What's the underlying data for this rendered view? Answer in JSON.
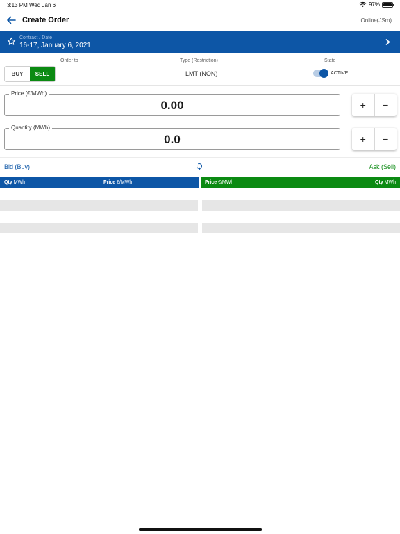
{
  "status_bar": {
    "time": "3:13 PM",
    "date": "Wed Jan 6",
    "battery": "97%",
    "battery_level": 0.97
  },
  "header": {
    "title": "Create Order",
    "connection": "Online(JSm)"
  },
  "contract": {
    "label": "Contract / Date",
    "value": "16-17, January 6, 2021"
  },
  "order": {
    "order_to_label": "Order to",
    "buy_label": "BUY",
    "sell_label": "SELL",
    "selected_side": "SELL",
    "type_label": "Type (Restriction)",
    "type_value": "LMT (NON)",
    "state_label": "State",
    "state_value": "ACTIVE",
    "state_on": true
  },
  "price": {
    "label": "Price (€/MWh)",
    "value": "0.00",
    "plus": "+",
    "minus": "−"
  },
  "quantity": {
    "label": "Quantity (MWh)",
    "value": "0.0",
    "plus": "+",
    "minus": "−"
  },
  "book": {
    "bid_title": "Bid (Buy)",
    "ask_title": "Ask (Sell)",
    "bid_columns": {
      "qty": "Qty",
      "qty_unit": "MWh",
      "price": "Price",
      "price_unit": "€/MWh"
    },
    "ask_columns": {
      "price": "Price",
      "price_unit": "€/MWh",
      "qty": "Qty",
      "qty_unit": "MWh"
    }
  },
  "colors": {
    "bid_blue": "#0d56a6",
    "ask_green": "#0b8a12",
    "placeholder_gray": "#e6e6e6"
  }
}
